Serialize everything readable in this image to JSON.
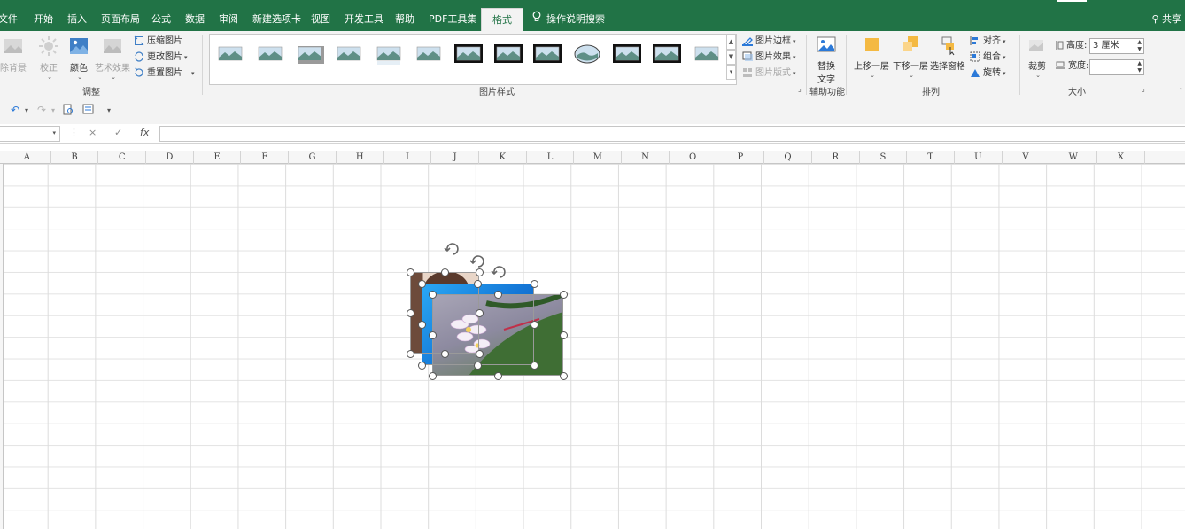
{
  "tabs": [
    {
      "label": "文件",
      "active": false
    },
    {
      "label": "开始",
      "active": false
    },
    {
      "label": "插入",
      "active": false
    },
    {
      "label": "页面布局",
      "active": false
    },
    {
      "label": "公式",
      "active": false
    },
    {
      "label": "数据",
      "active": false
    },
    {
      "label": "审阅",
      "active": false
    },
    {
      "label": "新建选项卡",
      "active": false
    },
    {
      "label": "视图",
      "active": false
    },
    {
      "label": "开发工具",
      "active": false
    },
    {
      "label": "帮助",
      "active": false
    },
    {
      "label": "PDF工具集",
      "active": false
    },
    {
      "label": "格式",
      "active": true
    }
  ],
  "tell_me": "操作说明搜索",
  "share": "共享",
  "groups": {
    "adjust": {
      "label": "调整",
      "remove_bg": "除背景",
      "corrections": "校正",
      "color": "颜色",
      "artistic": "艺术效果",
      "compress": "压缩图片",
      "change": "更改图片",
      "reset": "重置图片"
    },
    "styles": {
      "label": "图片样式",
      "border": "图片边框",
      "effects": "图片效果",
      "layout": "图片版式",
      "gallery_count": 13
    },
    "accessibility": {
      "label": "辅助功能",
      "alt_text_line1": "替换",
      "alt_text_line2": "文字"
    },
    "arrange": {
      "label": "排列",
      "bring_forward": "上移一层",
      "send_backward": "下移一层",
      "selection_pane": "选择窗格",
      "align": "对齐",
      "group": "组合",
      "rotate": "旋转"
    },
    "size": {
      "label": "大小",
      "crop": "裁剪",
      "height_label": "高度:",
      "height_value": "3 厘米",
      "width_label": "宽度:",
      "width_value": ""
    }
  },
  "formula_bar": {
    "name_box": "",
    "cancel": "×",
    "enter": "✓",
    "fx": "fx",
    "formula": ""
  },
  "columns": [
    "A",
    "B",
    "C",
    "D",
    "E",
    "F",
    "G",
    "H",
    "I",
    "J",
    "K",
    "L",
    "M",
    "N",
    "O",
    "P",
    "Q",
    "R",
    "S",
    "T",
    "U",
    "V",
    "W",
    "X"
  ],
  "colors": {
    "ribbon_green": "#217346",
    "ribbon_bg": "#f3f3f3",
    "accent_blue": "#2b79d8"
  }
}
